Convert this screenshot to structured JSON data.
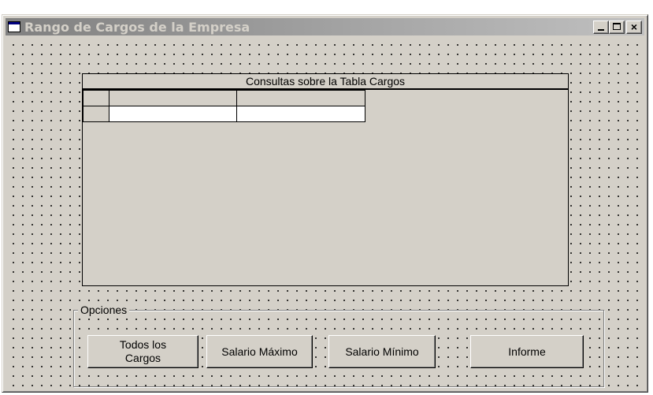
{
  "window": {
    "title": "Rango de Cargos de la Empresa",
    "icon": "form-icon",
    "controls": {
      "minimize": "_",
      "maximize": "□",
      "close": "×"
    }
  },
  "grid": {
    "caption": "Consultas sobre la Tabla Cargos",
    "columns": [
      "",
      ""
    ],
    "rows": [
      [
        "",
        ""
      ]
    ]
  },
  "options": {
    "label": "Opciones",
    "buttons": {
      "todos": "Todos los\nCargos",
      "maximo": "Salario Máximo",
      "minimo": "Salario Mínimo",
      "informe": "Informe"
    }
  },
  "colors": {
    "face": "#d4d0c8",
    "title_gradient_start": "#808080",
    "title_gradient_end": "#c0c0c0",
    "cell": "#ffffff"
  }
}
